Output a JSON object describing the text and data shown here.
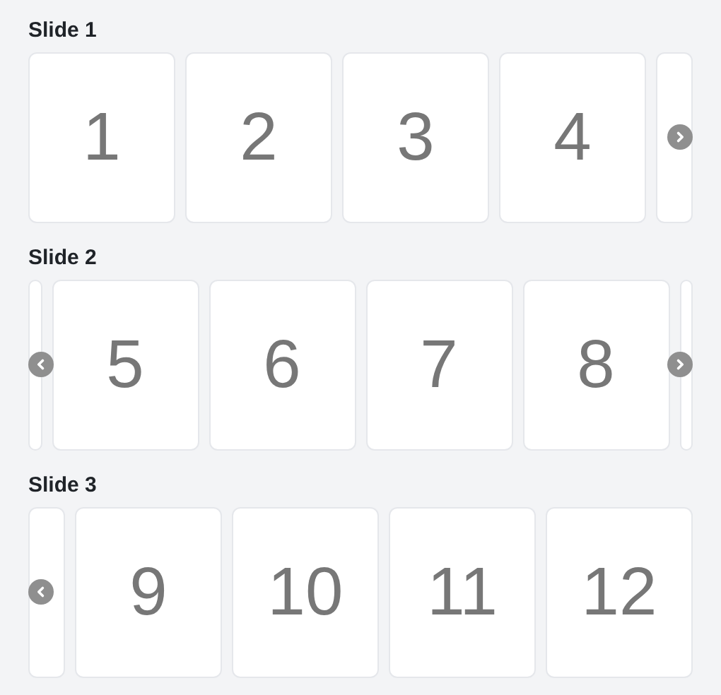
{
  "sections": [
    {
      "title": "Slide 1",
      "leading_card": false,
      "trailing_card": true,
      "prev_button": false,
      "next_button": true,
      "cards": [
        "1",
        "2",
        "3",
        "4"
      ]
    },
    {
      "title": "Slide 2",
      "leading_card": true,
      "trailing_card": true,
      "prev_button": true,
      "next_button": true,
      "cards": [
        "5",
        "6",
        "7",
        "8"
      ]
    },
    {
      "title": "Slide 3",
      "leading_card": true,
      "trailing_card": false,
      "prev_button": true,
      "next_button": false,
      "cards": [
        "9",
        "10",
        "11",
        "12"
      ]
    }
  ]
}
